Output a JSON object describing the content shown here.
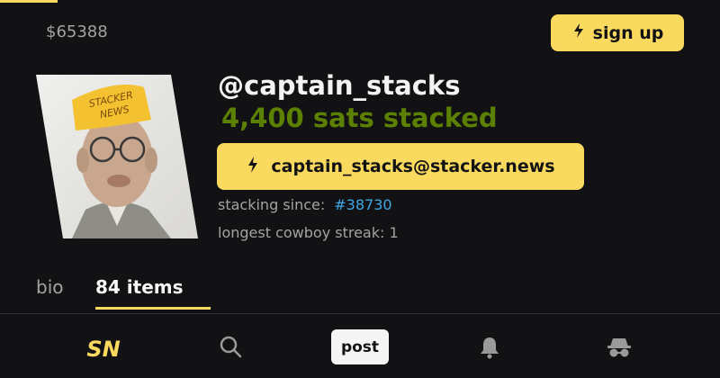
{
  "header": {
    "price": "$65388",
    "signup_label": "sign up"
  },
  "profile": {
    "avatar_hat_text_line1": "STACKER",
    "avatar_hat_text_line2": "NEWS",
    "username": "@captain_stacks",
    "sats_stacked": "4,400 sats stacked",
    "lightning_address": "captain_stacks@stacker.news",
    "stacking_since_label": "stacking since:",
    "stacking_since_link": "#38730",
    "streak_text": "longest cowboy streak: 1"
  },
  "tabs": [
    {
      "label": "bio",
      "active": false
    },
    {
      "label": "84 items",
      "active": true
    }
  ],
  "bottom_nav": {
    "logo_text": "SN",
    "post_label": "post",
    "icons": [
      "sn-logo-icon",
      "search-icon",
      "bell-icon",
      "incognito-icon"
    ]
  },
  "colors": {
    "background": "#121214",
    "accent": "#fada5e",
    "sats_green": "#5c8001",
    "link_blue": "#3ea8e5",
    "muted_text": "#a3a3a3"
  }
}
